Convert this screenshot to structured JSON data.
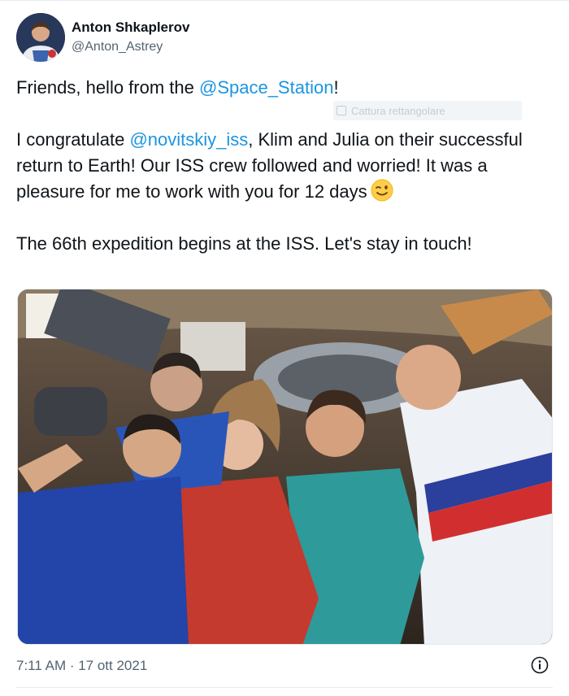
{
  "author": {
    "display_name": "Anton Shkaplerov",
    "handle": "@Anton_Astrey",
    "avatar_icon": "astronaut-avatar"
  },
  "tweet": {
    "line1_prefix": "Friends, hello from the ",
    "line1_mention": "@Space_Station",
    "line1_suffix": "!",
    "line2_prefix": "I congratulate ",
    "line2_mention": "@novitskiy_iss",
    "line2_suffix": ", Klim and Julia on their successful return to Earth! Our ISS crew followed and worried! It was a pleasure for me to work with you for 12 days",
    "emoji": "winking-face-emoji",
    "line3": "The 66th expedition begins at the ISS. Let's stay in touch!"
  },
  "overlay": {
    "ghost_tooltip": "Cattura rettangolare"
  },
  "media": {
    "photo_icon": "crew-photo"
  },
  "meta": {
    "timestamp": "7:11 AM · 17 ott 2021",
    "info_icon": "info-icon"
  },
  "colors": {
    "mention": "#1b95e0",
    "text": "#0f1419",
    "secondary": "#536471"
  }
}
